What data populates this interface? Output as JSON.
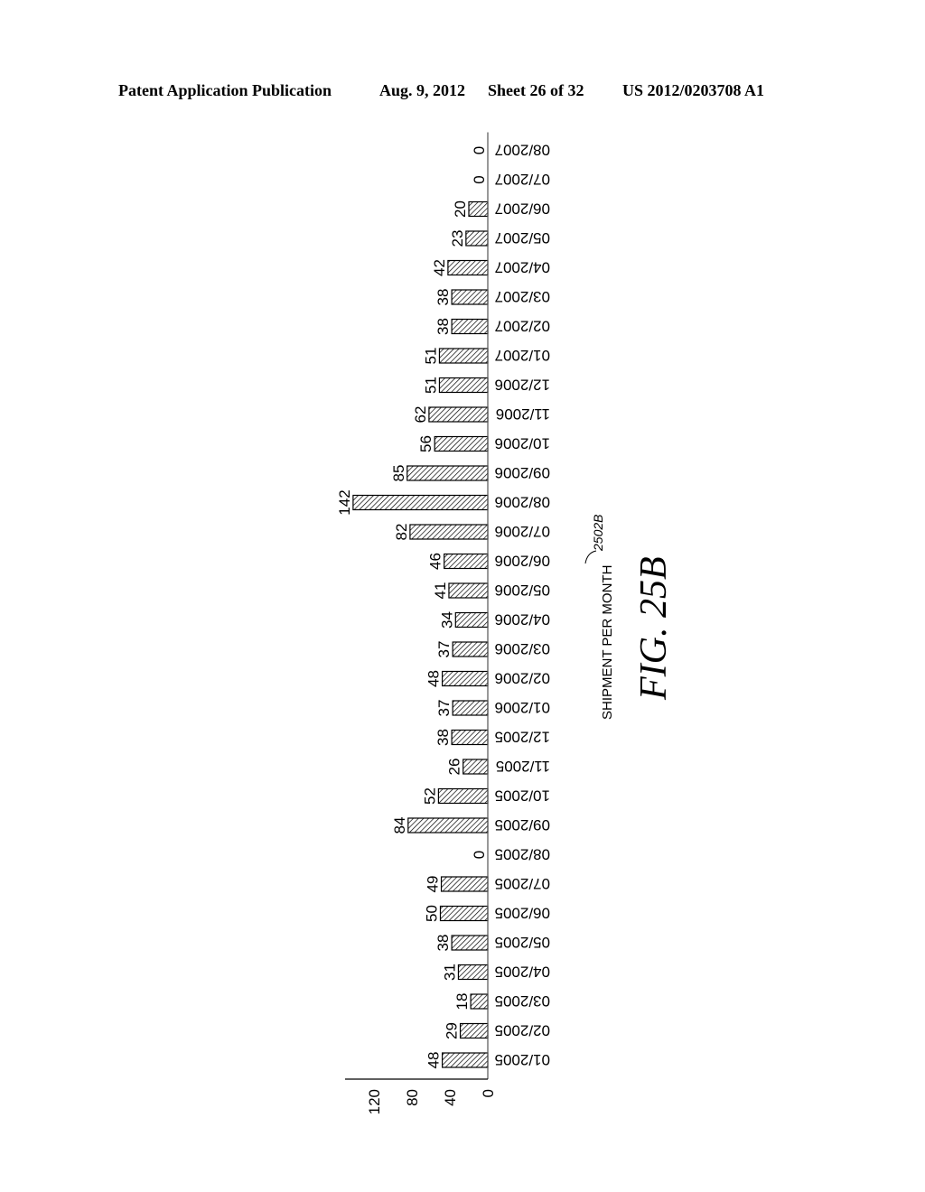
{
  "header": {
    "left": "Patent Application Publication",
    "date": "Aug. 9, 2012",
    "sheet": "Sheet 26 of 32",
    "number": "US 2012/0203708 A1"
  },
  "figure": {
    "title": "FIG. 25B",
    "reference": "2502B"
  },
  "chart_data": {
    "type": "bar",
    "orientation": "horizontal-rotated",
    "title": "",
    "xlabel": "",
    "ylabel": "SHIPMENT PER MONTH",
    "categories": [
      "01/2005",
      "02/2005",
      "03/2005",
      "04/2005",
      "05/2005",
      "06/2005",
      "07/2005",
      "08/2005",
      "09/2005",
      "10/2005",
      "11/2005",
      "12/2005",
      "01/2006",
      "02/2006",
      "03/2006",
      "04/2006",
      "05/2006",
      "06/2006",
      "07/2006",
      "08/2006",
      "09/2006",
      "10/2006",
      "11/2006",
      "12/2006",
      "01/2007",
      "02/2007",
      "03/2007",
      "04/2007",
      "05/2007",
      "06/2007",
      "07/2007",
      "08/2007"
    ],
    "values": [
      48,
      29,
      18,
      31,
      38,
      50,
      49,
      0,
      84,
      52,
      26,
      38,
      37,
      48,
      37,
      34,
      41,
      46,
      82,
      142,
      85,
      56,
      62,
      51,
      51,
      38,
      38,
      42,
      23,
      20,
      0,
      0
    ],
    "value_ticks": [
      0,
      40,
      80,
      120
    ],
    "ylim": [
      0,
      150
    ],
    "grid": false,
    "bar_fill": "diagonal-hatch"
  }
}
